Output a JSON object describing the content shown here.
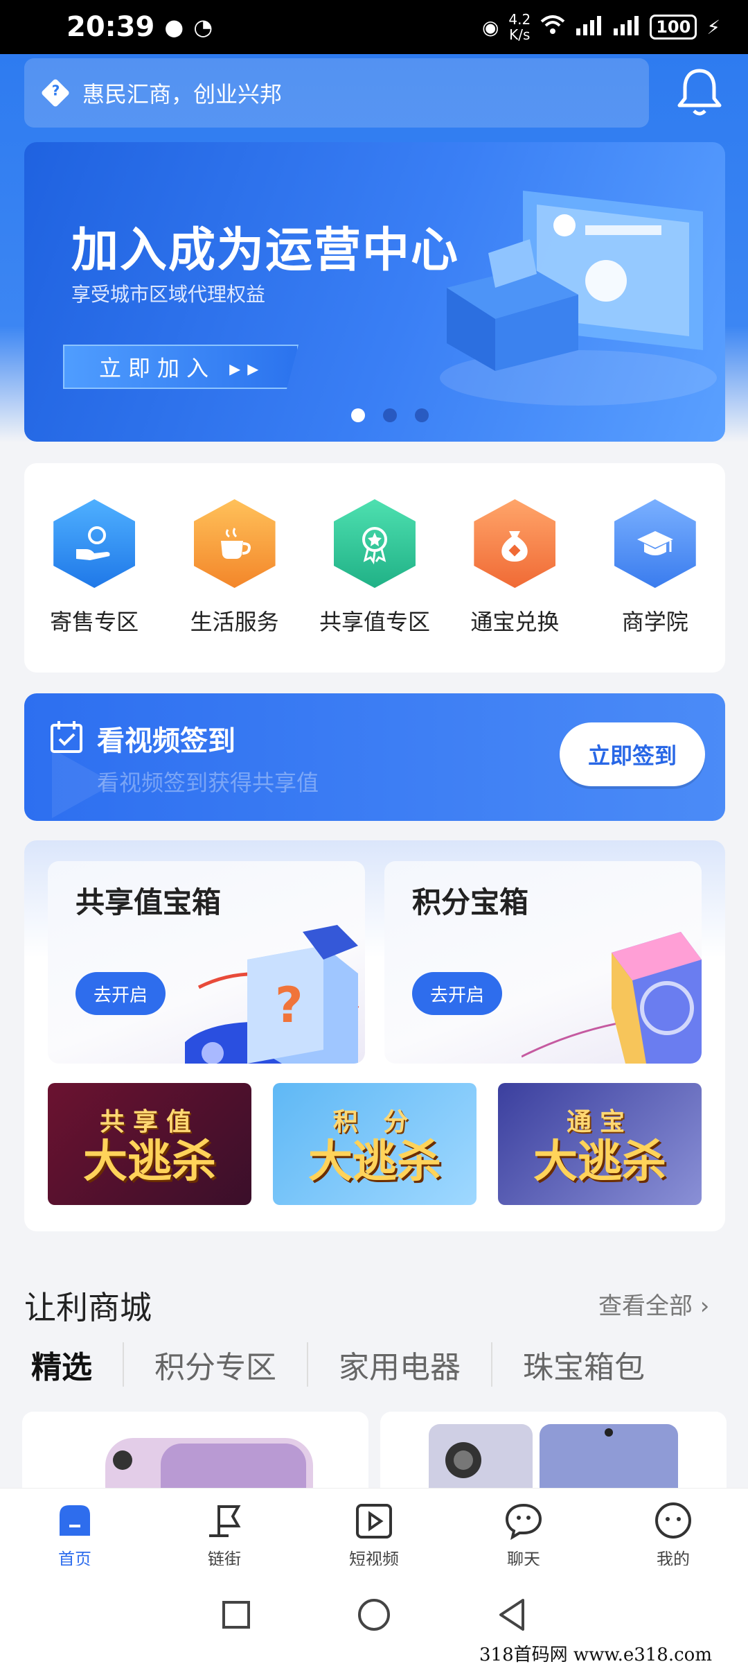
{
  "status_bar": {
    "time": "20:39",
    "speed_top": "4.2",
    "speed_bottom": "K/s",
    "battery": "100"
  },
  "header": {
    "slogan": "惠民汇商，创业兴邦"
  },
  "banner": {
    "title": "加入成为运营中心",
    "subtitle": "享受城市区域代理权益",
    "join_label": "立即加入 ▸▸",
    "slide_count": 3,
    "active_slide": 1
  },
  "quick_menu": [
    {
      "label": "寄售专区",
      "icon": "hand-coin-icon",
      "color": "#2f8ff0"
    },
    {
      "label": "生活服务",
      "icon": "coffee-cup-icon",
      "color": "#f7a13a"
    },
    {
      "label": "共享值专区",
      "icon": "award-medal-icon",
      "color": "#2ec79c"
    },
    {
      "label": "通宝兑换",
      "icon": "money-bag-icon",
      "color": "#f47b45"
    },
    {
      "label": "商学院",
      "icon": "graduation-cap-icon",
      "color": "#4f8ef5"
    }
  ],
  "signin": {
    "title": "看视频签到",
    "subtitle": "看视频签到获得共享值",
    "button": "立即签到"
  },
  "treasure": {
    "cards": [
      {
        "title": "共享值宝箱",
        "button": "去开启"
      },
      {
        "title": "积分宝箱",
        "button": "去开启"
      }
    ],
    "sales": [
      {
        "top": "共享值",
        "big": "大逃杀"
      },
      {
        "top": "积 分",
        "big": "大逃杀"
      },
      {
        "top": "通宝",
        "big": "大逃杀"
      }
    ]
  },
  "mall": {
    "title": "让利商城",
    "more": "查看全部 ›",
    "tabs": [
      "精选",
      "积分专区",
      "家用电器",
      "珠宝箱包"
    ]
  },
  "bottom_nav": [
    {
      "label": "首页",
      "active": true
    },
    {
      "label": "链街"
    },
    {
      "label": "短视频"
    },
    {
      "label": "聊天"
    },
    {
      "label": "我的"
    }
  ],
  "watermark": "318首码网   www.e318.com"
}
